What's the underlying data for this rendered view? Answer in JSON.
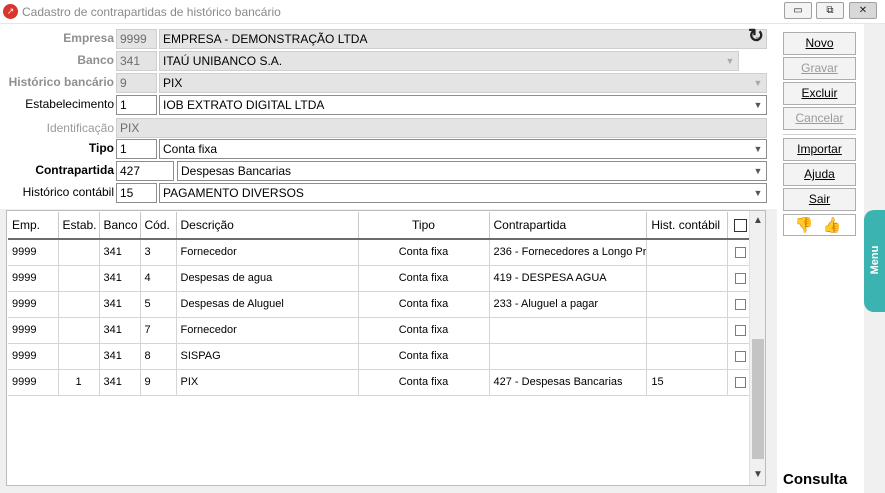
{
  "window": {
    "title": "Cadastro de contrapartidas de histórico bancário",
    "app_icon": "chart-icon",
    "controls": {
      "minimize": "▭",
      "restore": "⧉",
      "close": "✕"
    }
  },
  "form": {
    "empresa": {
      "label": "Empresa",
      "code": "9999",
      "name": "EMPRESA - DEMONSTRAÇÃO LTDA"
    },
    "banco": {
      "label": "Banco",
      "code": "341",
      "name": "ITAÚ UNIBANCO S.A."
    },
    "historico_bancario": {
      "label": "Histórico bancário",
      "code": "9",
      "name": "PIX"
    },
    "estabelecimento": {
      "label": "Estabelecimento",
      "code": "1",
      "name": "IOB EXTRATO DIGITAL LTDA"
    },
    "identificacao": {
      "label": "Identificação",
      "value": "PIX"
    },
    "tipo": {
      "label": "Tipo",
      "code": "1",
      "name": "Conta fixa"
    },
    "contrapartida": {
      "label": "Contrapartida",
      "code": "427",
      "name": "Despesas Bancarias"
    },
    "historico_contabil": {
      "label": "Histórico contábil",
      "code": "15",
      "name": "PAGAMENTO DIVERSOS"
    }
  },
  "grid": {
    "columns": [
      "Emp.",
      "Estab.",
      "Banco",
      "Cód.",
      "Descrição",
      "Tipo",
      "Contrapartida",
      "Hist. contábil"
    ],
    "rows": [
      {
        "emp": "9999",
        "estab": "",
        "banco": "341",
        "cod": "3",
        "descricao": "Fornecedor",
        "tipo": "Conta fixa",
        "contrapartida": "236 - Fornecedores a Longo Pr",
        "hist": ""
      },
      {
        "emp": "9999",
        "estab": "",
        "banco": "341",
        "cod": "4",
        "descricao": "Despesas de agua",
        "tipo": "Conta fixa",
        "contrapartida": "419 - DESPESA AGUA",
        "hist": ""
      },
      {
        "emp": "9999",
        "estab": "",
        "banco": "341",
        "cod": "5",
        "descricao": "Despesas de Aluguel",
        "tipo": "Conta fixa",
        "contrapartida": "233 - Aluguel a pagar",
        "hist": ""
      },
      {
        "emp": "9999",
        "estab": "",
        "banco": "341",
        "cod": "7",
        "descricao": "Fornecedor",
        "tipo": "Conta fixa",
        "contrapartida": "",
        "hist": ""
      },
      {
        "emp": "9999",
        "estab": "",
        "banco": "341",
        "cod": "8",
        "descricao": "SISPAG",
        "tipo": "Conta fixa",
        "contrapartida": "",
        "hist": ""
      },
      {
        "emp": "9999",
        "estab": "1",
        "banco": "341",
        "cod": "9",
        "descricao": "PIX",
        "tipo": "Conta fixa",
        "contrapartida": "427 - Despesas Bancarias",
        "hist": "15"
      }
    ]
  },
  "buttons": {
    "novo": "Novo",
    "gravar": "Gravar",
    "excluir": "Excluir",
    "cancelar": "Cancelar",
    "importar": "Importar",
    "ajuda": "Ajuda",
    "sair": "Sair"
  },
  "status_label": "Consulta",
  "side_tab": "Menu",
  "colors": {
    "accent": "#3bb3b0",
    "icon_red": "#d9352a"
  }
}
